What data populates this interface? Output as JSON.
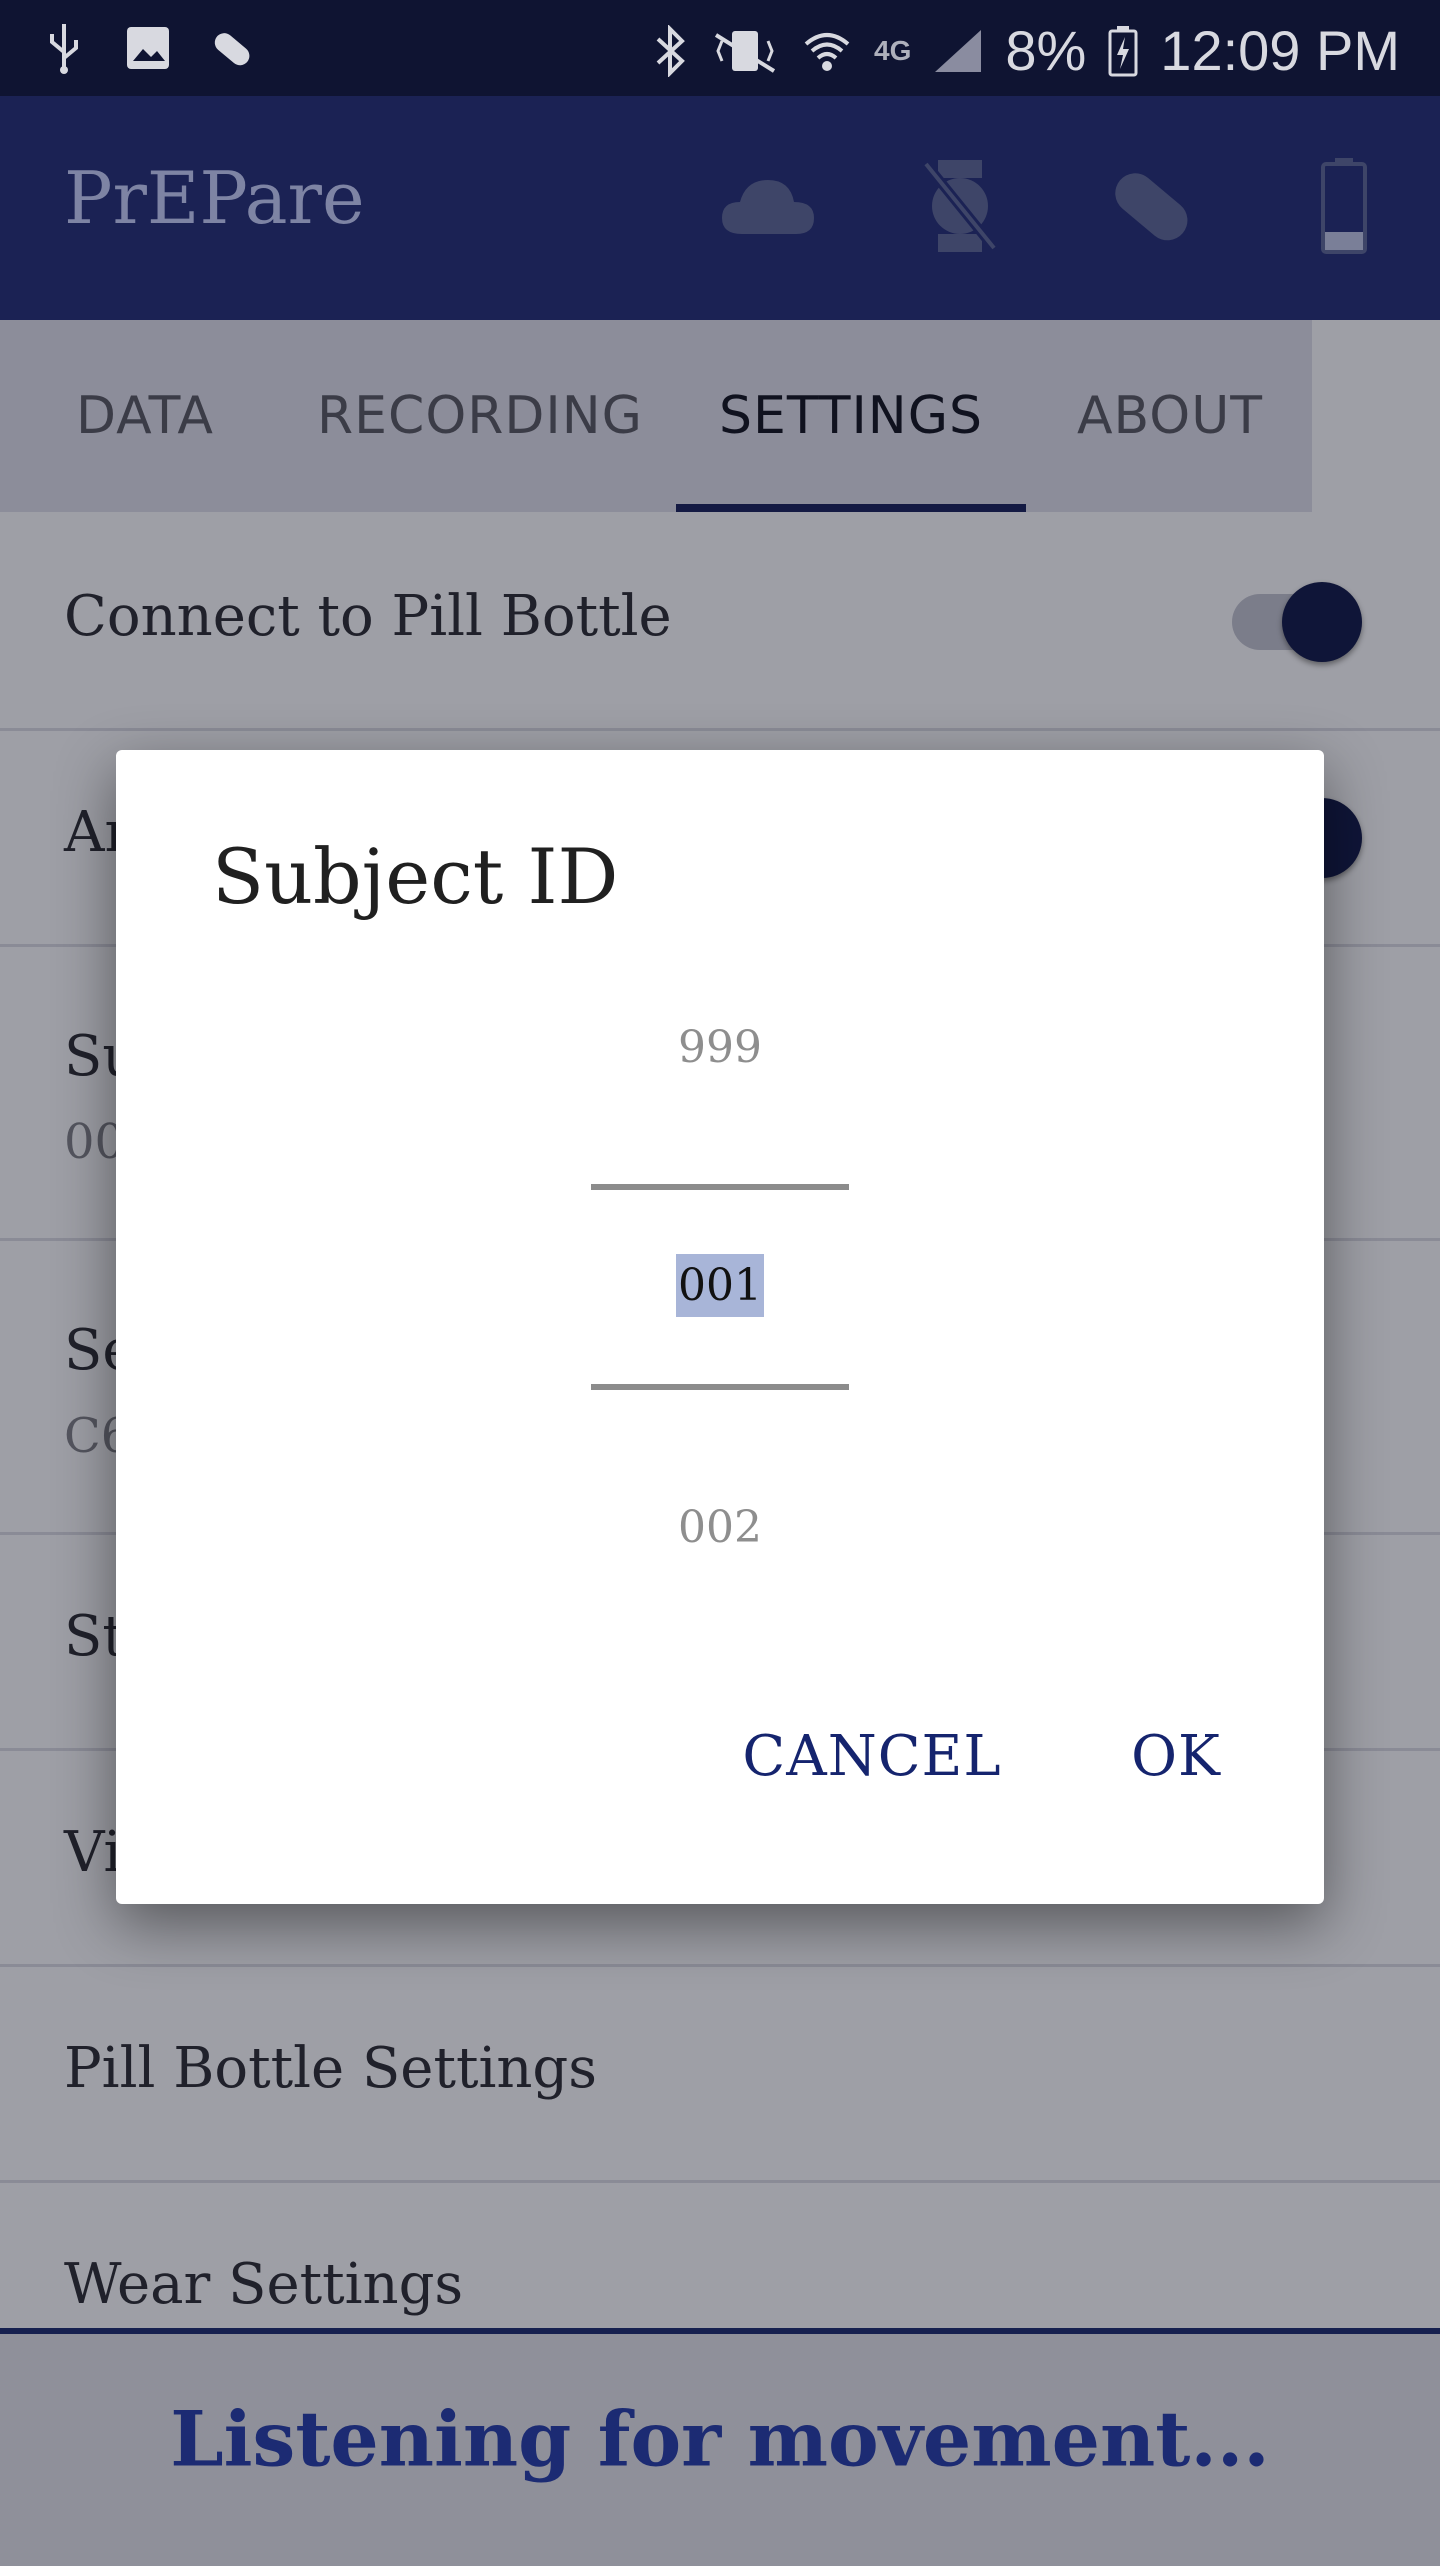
{
  "status_bar": {
    "battery": "8%",
    "time": "12:09 PM",
    "network": "4G",
    "icons_left": [
      "usb-icon",
      "image-icon",
      "pill-icon"
    ],
    "icons_right": [
      "bluetooth-icon",
      "vibrate-mute-icon",
      "wifi-icon",
      "signal-icon",
      "battery-charging-icon"
    ]
  },
  "app_bar": {
    "title": "PrEPare",
    "actions": [
      "cloud-icon",
      "watch-off-icon",
      "pill-icon",
      "battery-icon"
    ]
  },
  "tabs": [
    {
      "label": "DATA",
      "active": false
    },
    {
      "label": "RECORDING",
      "active": false
    },
    {
      "label": "SETTINGS",
      "active": true
    },
    {
      "label": "ABOUT",
      "active": false
    }
  ],
  "settings": {
    "rows": [
      {
        "title": "Connect to Pill Bottle",
        "toggle": true
      },
      {
        "title": "Ar",
        "toggle": true
      },
      {
        "title": "Su",
        "subtitle": "00"
      },
      {
        "title": "Se",
        "subtitle": "C6"
      },
      {
        "title": "St"
      },
      {
        "title": "Vi"
      },
      {
        "title": "Pill Bottle Settings"
      },
      {
        "title": "Wear Settings"
      }
    ]
  },
  "dialog": {
    "title": "Subject ID",
    "picker": {
      "previous": "999",
      "current": "001",
      "next": "002"
    },
    "cancel_label": "CANCEL",
    "ok_label": "OK"
  },
  "bottom_banner": {
    "text": "Listening for movement..."
  },
  "colors": {
    "primary": "#1b2254",
    "status_bar": "#0f1432",
    "accent": "#15246e",
    "scrim": "#9e9fa6"
  }
}
